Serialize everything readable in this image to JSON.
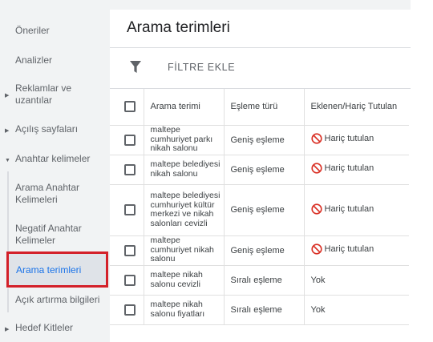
{
  "sidebar": {
    "items": [
      {
        "label": "Öneriler"
      },
      {
        "label": "Analizler"
      },
      {
        "label": "Reklamlar ve uzantılar"
      },
      {
        "label": "Açılış sayfaları"
      },
      {
        "label": "Anahtar kelimeler"
      },
      {
        "label": "Arama Anahtar Kelimeleri"
      },
      {
        "label": "Negatif Anahtar Kelimeler"
      },
      {
        "label": "Arama terimleri"
      },
      {
        "label": "Açık artırma bilgileri"
      },
      {
        "label": "Hedef Kitleler"
      }
    ]
  },
  "main": {
    "title": "Arama terimleri",
    "filter_label": "FİLTRE EKLE"
  },
  "table": {
    "headers": [
      "Arama terimi",
      "Eşleme türü",
      "Eklenen/Hariç Tutulan"
    ],
    "rows": [
      {
        "term": "maltepe cumhuriyet parkı nikah salonu",
        "match": "Geniş eşleme",
        "status": "Hariç tutulan",
        "status_icon": "ban-icon"
      },
      {
        "term": "maltepe belediyesi nikah salonu",
        "match": "Geniş eşleme",
        "status": "Hariç tutulan",
        "status_icon": "ban-icon"
      },
      {
        "term": "maltepe belediyesi cumhuriyet kültür merkezi ve nikah salonları cevizli",
        "match": "Geniş eşleme",
        "status": "Hariç tutulan",
        "status_icon": "ban-icon"
      },
      {
        "term": "maltepe cumhuriyet nikah salonu",
        "match": "Geniş eşleme",
        "status": "Hariç tutulan",
        "status_icon": "ban-icon"
      },
      {
        "term": "maltepe nikah salonu cevizli",
        "match": "Sıralı eşleme",
        "status": "Yok",
        "status_icon": ""
      },
      {
        "term": "maltepe nikah salonu fiyatları",
        "match": "Sıralı eşleme",
        "status": "Yok",
        "status_icon": ""
      }
    ]
  },
  "colors": {
    "active_link": "#1a73e8",
    "highlight_border": "#d32029",
    "exclude_icon": "#d93025"
  }
}
